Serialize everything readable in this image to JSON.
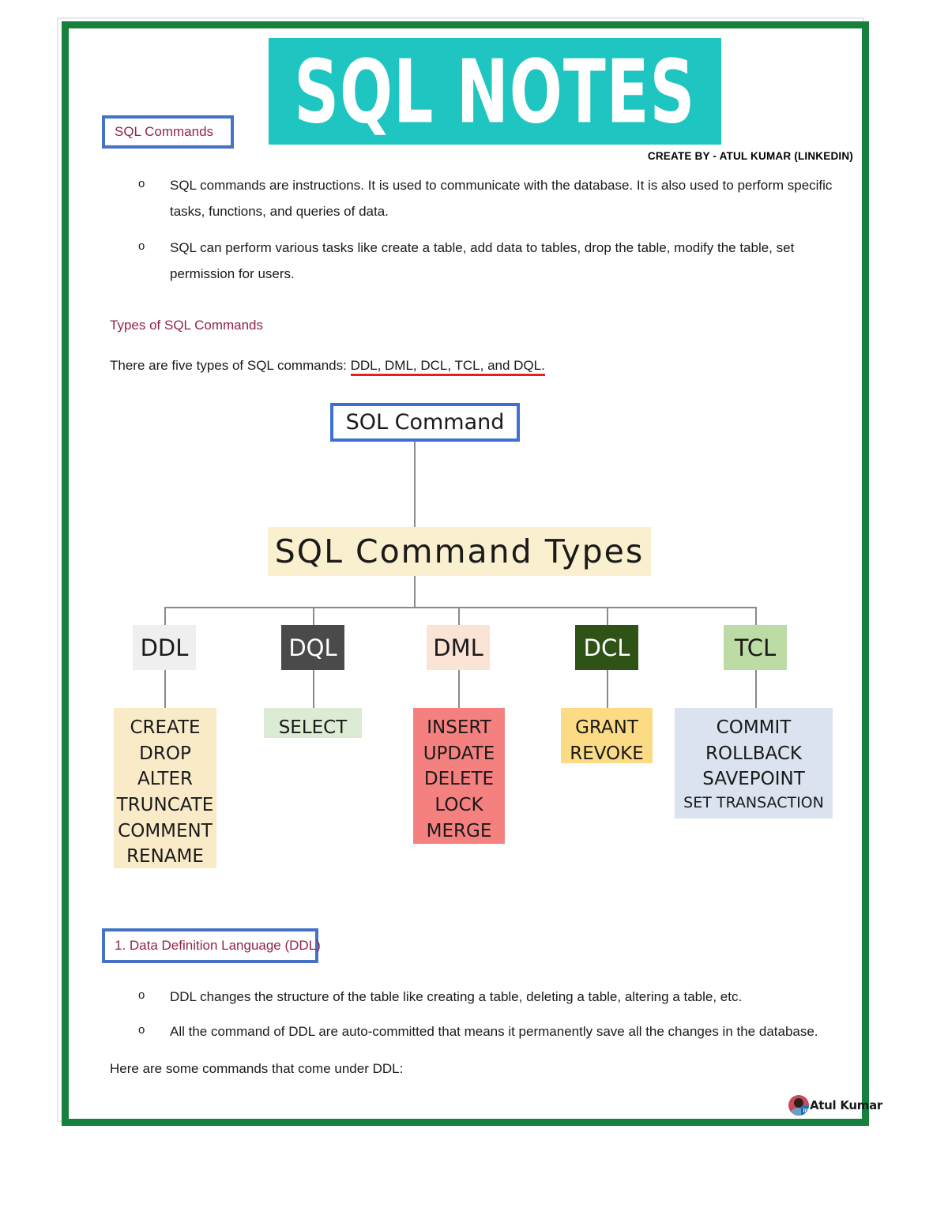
{
  "document": {
    "banner_title": "SQL NOTES",
    "credit": "CREATE BY - ATUL KUMAR (LINKEDIN)",
    "watermark_name": "Atul Kumar",
    "border_color": "#16803C",
    "banner_color": "#1FC5C0",
    "accent_color": "#92234B",
    "callout_border_color": "#4472C4"
  },
  "section1": {
    "heading": "SQL Commands",
    "bullets": [
      {
        "marker": "o",
        "text": "SQL commands are instructions. It is used to communicate with the database. It is also used to perform specific tasks, functions, and queries of data."
      },
      {
        "marker": "o",
        "text": "SQL can perform various tasks like create a table, add data to tables, drop the table, modify the table, set permission for users."
      }
    ],
    "subheading": "Types of SQL Commands",
    "intro_prefix": "There are five types of SQL commands: ",
    "intro_highlight": "DDL, DML, DCL, TCL, and DQL."
  },
  "diagram": {
    "root_label": "SOL Command",
    "types_label": "SQL  Command  Types",
    "categories": [
      {
        "name": "DDL",
        "box_bg": "#EFEFEF",
        "box_fg": "#1a1a1a",
        "commands": [
          "CREATE",
          "DROP",
          "ALTER",
          "TRUNCATE",
          "COMMENT",
          "RENAME"
        ],
        "commands_bg": "#FAEBC8"
      },
      {
        "name": "DQL",
        "box_bg": "#4A4A4A",
        "box_fg": "#ffffff",
        "commands": [
          "SELECT"
        ],
        "commands_bg": "#DCEBD3"
      },
      {
        "name": "DML",
        "box_bg": "#FBE3D6",
        "box_fg": "#1a1a1a",
        "commands": [
          "INSERT",
          "UPDATE",
          "DELETE",
          "LOCK",
          "MERGE"
        ],
        "commands_bg": "#F58080"
      },
      {
        "name": "DCL",
        "box_bg": "#2F5217",
        "box_fg": "#ffffff",
        "commands": [
          "GRANT",
          "REVOKE"
        ],
        "commands_bg": "#FBDB84"
      },
      {
        "name": "TCL",
        "box_bg": "#BDDCA5",
        "box_fg": "#1a1a1a",
        "commands": [
          "COMMIT",
          "ROLLBACK",
          "SAVEPOINT",
          "SET TRANSACTION"
        ],
        "commands_bg": "#DAE3EF"
      }
    ]
  },
  "section2": {
    "heading": "1. Data Definition Language (DDL)",
    "bullets": [
      {
        "marker": "o",
        "text": "DDL changes the structure of the table like creating a table, deleting a table, altering a table, etc."
      },
      {
        "marker": "o",
        "text": "All the command of DDL are auto-committed that means it permanently save all the changes in the database."
      }
    ],
    "closing": "Here are some commands that come under DDL:"
  }
}
